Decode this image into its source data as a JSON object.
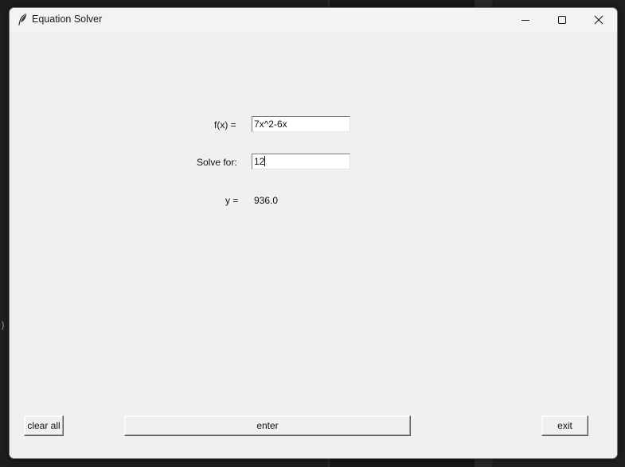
{
  "window": {
    "title": "Equation Solver",
    "icon": "feather-icon",
    "controls": {
      "minimize": "minimize-icon",
      "maximize": "maximize-icon",
      "close": "close-icon"
    }
  },
  "form": {
    "fx_label": "f(x) =",
    "fx_value": "7x^2-6x",
    "solve_label": "Solve for:",
    "solve_value": "12",
    "y_label": "y =",
    "y_result": "936.0"
  },
  "buttons": {
    "clear_label": "clear all",
    "enter_label": "enter",
    "exit_label": "exit"
  },
  "background": {
    "fragment": ")"
  }
}
